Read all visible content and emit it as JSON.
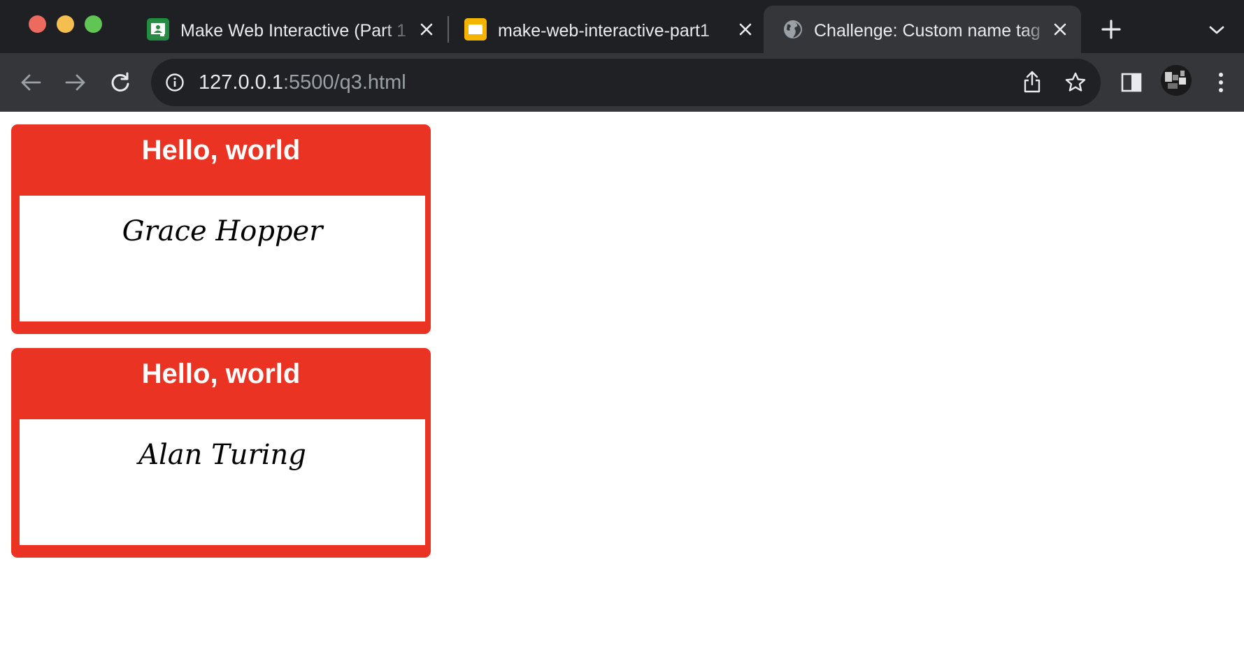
{
  "browser": {
    "tabs": [
      {
        "title": "Make Web Interactive (Part 1)",
        "favicon": "classroom-icon",
        "active": false
      },
      {
        "title": "make-web-interactive-part1",
        "favicon": "slides-icon",
        "active": false
      },
      {
        "title": "Challenge: Custom name tag",
        "favicon": "globe-icon",
        "active": true
      }
    ],
    "address": {
      "host": "127.0.0.1",
      "rest": ":5500/q3.html"
    },
    "colors": {
      "tabstrip": "#1f2023",
      "toolbar": "#35363a",
      "omnibox": "#202124"
    }
  },
  "page": {
    "nametags": [
      {
        "greeting": "Hello, world",
        "name": "Grace Hopper"
      },
      {
        "greeting": "Hello, world",
        "name": "Alan Turing"
      }
    ],
    "colors": {
      "tag_red": "#ea3323",
      "tag_white": "#ffffff"
    }
  }
}
